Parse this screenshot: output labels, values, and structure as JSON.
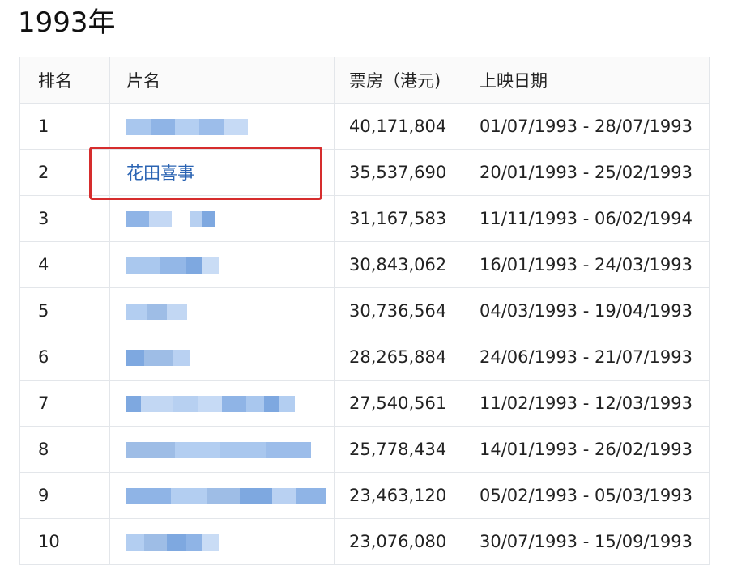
{
  "page": {
    "title": "1993年"
  },
  "colors": {
    "link": "#2b64b3",
    "highlight": "#d62d2d",
    "pixelated": "#9ebde6"
  },
  "table": {
    "headers": {
      "rank": "排名",
      "title": "片名",
      "box_office": "票房（港元)",
      "dates": "上映日期"
    },
    "rows": [
      {
        "rank": "1",
        "title": "",
        "blurred": true,
        "box_office": "40,171,804",
        "dates": "01/07/1993 - 28/07/1993"
      },
      {
        "rank": "2",
        "title": "花田喜事",
        "blurred": false,
        "box_office": "35,537,690",
        "dates": "20/01/1993 - 25/02/1993"
      },
      {
        "rank": "3",
        "title": "",
        "blurred": true,
        "box_office": "31,167,583",
        "dates": "11/11/1993 - 06/02/1994"
      },
      {
        "rank": "4",
        "title": "",
        "blurred": true,
        "box_office": "30,843,062",
        "dates": "16/01/1993 - 24/03/1993"
      },
      {
        "rank": "5",
        "title": "",
        "blurred": true,
        "box_office": "30,736,564",
        "dates": "04/03/1993 - 19/04/1993"
      },
      {
        "rank": "6",
        "title": "",
        "blurred": true,
        "box_office": "28,265,884",
        "dates": "24/06/1993 - 21/07/1993"
      },
      {
        "rank": "7",
        "title": "",
        "blurred": true,
        "box_office": "27,540,561",
        "dates": "11/02/1993 - 12/03/1993"
      },
      {
        "rank": "8",
        "title": "",
        "blurred": true,
        "box_office": "25,778,434",
        "dates": "14/01/1993 - 26/02/1993"
      },
      {
        "rank": "9",
        "title": "",
        "blurred": true,
        "box_office": "23,463,120",
        "dates": "05/02/1993 - 05/03/1993"
      },
      {
        "rank": "10",
        "title": "",
        "blurred": true,
        "box_office": "23,076,080",
        "dates": "30/07/1993 - 15/09/1993"
      }
    ]
  }
}
